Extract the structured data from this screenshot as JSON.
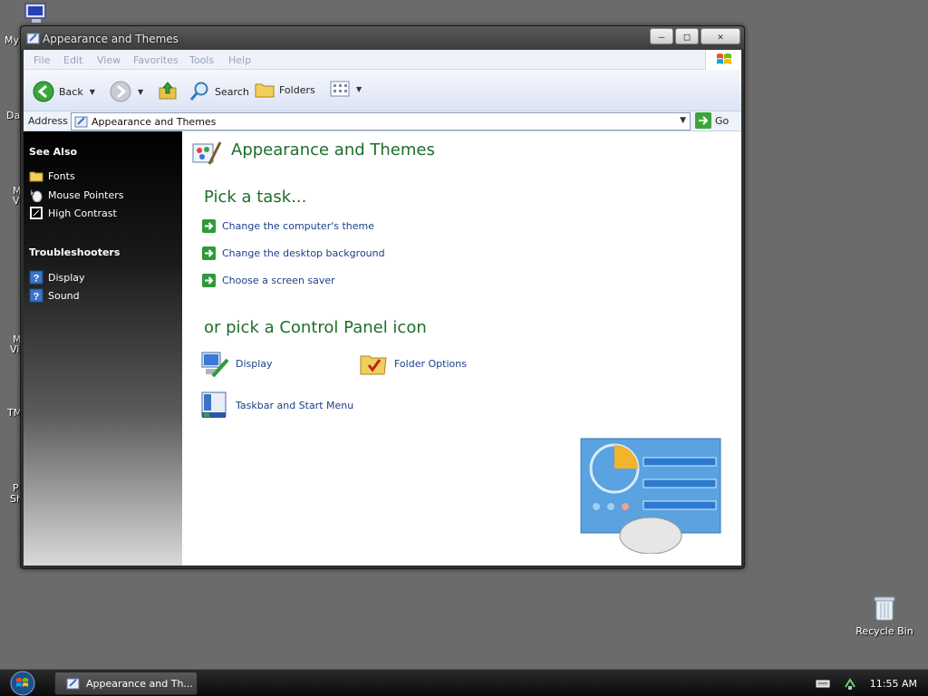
{
  "desktop": {
    "fragments": [
      "My",
      "Da",
      "M",
      "V",
      "M",
      "Vi",
      "TM",
      "P",
      "Sh"
    ],
    "recycle_bin_label": "Recycle Bin"
  },
  "window": {
    "title": "Appearance and Themes",
    "controls": {
      "minimize": "—",
      "maximize": "□",
      "close": "✕"
    }
  },
  "menubar": {
    "items": [
      "File",
      "Edit",
      "View",
      "Favorites",
      "Tools",
      "Help"
    ]
  },
  "toolbar": {
    "back_label": "Back",
    "search_label": "Search",
    "folders_label": "Folders"
  },
  "addressbar": {
    "label": "Address",
    "value": "Appearance and Themes",
    "go_label": "Go"
  },
  "sidebar": {
    "see_also_heading": "See Also",
    "see_also_items": [
      {
        "label": "Fonts",
        "icon": "folder-icon"
      },
      {
        "label": "Mouse Pointers",
        "icon": "mouse-icon"
      },
      {
        "label": "High Contrast",
        "icon": "contrast-icon"
      }
    ],
    "troubleshooters_heading": "Troubleshooters",
    "troubleshooter_items": [
      {
        "label": "Display",
        "icon": "help-icon"
      },
      {
        "label": "Sound",
        "icon": "help-icon"
      }
    ]
  },
  "main": {
    "title": "Appearance and Themes",
    "pick_task_heading": "Pick a task...",
    "tasks": [
      "Change the computer's theme",
      "Change the desktop background",
      "Choose a screen saver"
    ],
    "pick_icon_heading": "or pick a Control Panel icon",
    "icons": [
      {
        "label": "Display",
        "icon": "display-icon"
      },
      {
        "label": "Folder Options",
        "icon": "folder-options-icon"
      },
      {
        "label": "Taskbar and Start Menu",
        "icon": "taskbar-icon"
      }
    ]
  },
  "taskbar": {
    "window_button_label": "Appearance and Th...",
    "clock": "11:55 AM"
  },
  "colors": {
    "accent_green": "#1e6e2a",
    "link_blue": "#1b3f8a",
    "desktop_gray": "#6b6b6b"
  }
}
